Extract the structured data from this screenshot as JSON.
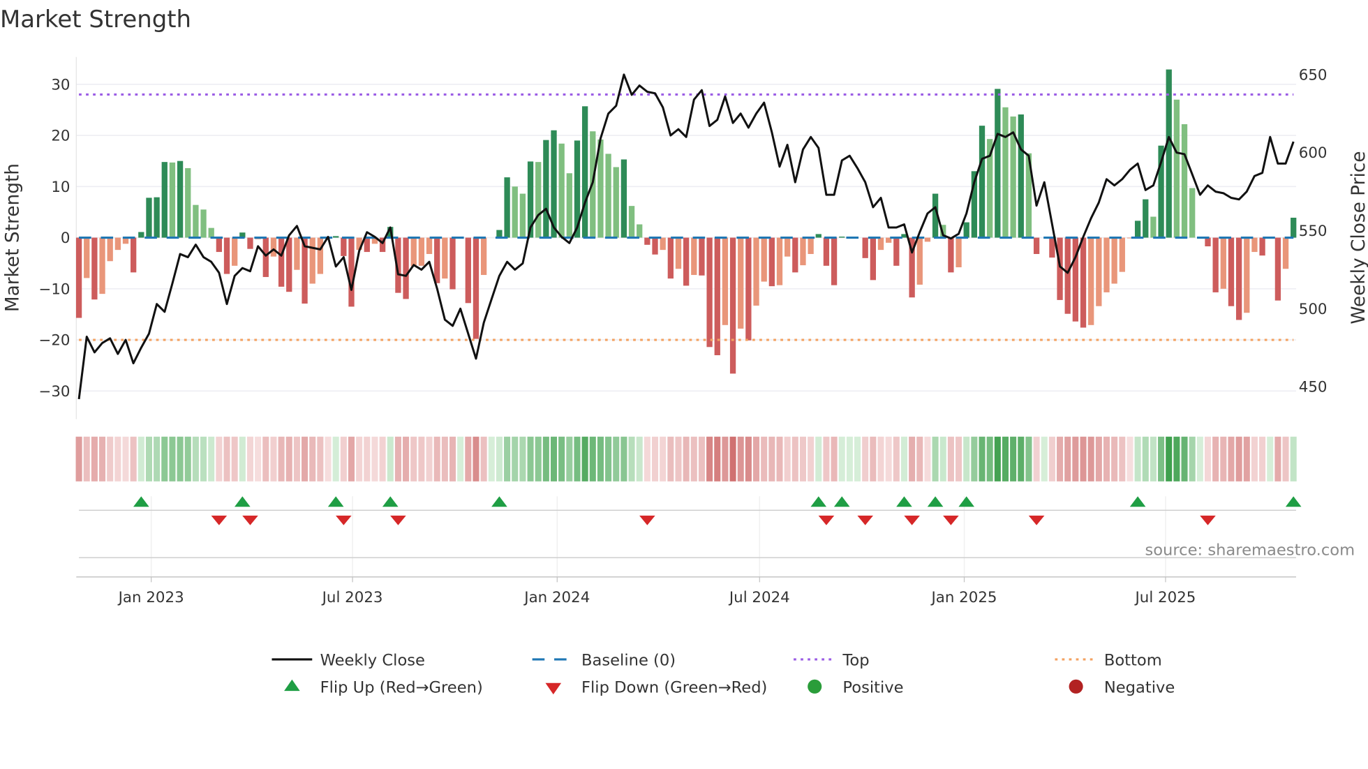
{
  "chart_data": {
    "type": "bar",
    "title": "Market Strength",
    "ylabel": "Market Strength",
    "y2label": "Weekly Close Price",
    "ylim": [
      -35,
      35
    ],
    "y2lim": [
      430,
      660
    ],
    "yticks": [
      -30,
      -20,
      -10,
      0,
      10,
      20,
      30
    ],
    "y2ticks": [
      450,
      500,
      550,
      600,
      650
    ],
    "start_date": "2022-10-28",
    "frequency": "weekly",
    "xticks": [
      {
        "date": "2023-01-01",
        "label": "Jan 2023"
      },
      {
        "date": "2023-07-01",
        "label": "Jul 2023"
      },
      {
        "date": "2024-01-01",
        "label": "Jan 2024"
      },
      {
        "date": "2024-07-01",
        "label": "Jul 2024"
      },
      {
        "date": "2025-01-01",
        "label": "Jan 2025"
      },
      {
        "date": "2025-07-01",
        "label": "Jul 2025"
      }
    ],
    "top_level": 28,
    "bottom_level": -20,
    "baseline": 0,
    "grid": true,
    "legend_position": "bottom",
    "series": [
      {
        "name": "Market Strength",
        "values": [
          -15.7,
          -7.9,
          -12.1,
          -11,
          -4.6,
          -2.4,
          -1.2,
          -6.8,
          1.1,
          7.8,
          7.9,
          14.8,
          14.7,
          15,
          13.6,
          6.4,
          5.5,
          1.9,
          -2.8,
          -7.1,
          -5.5,
          1,
          -2.2,
          -0.3,
          -7.7,
          -3.7,
          -9.6,
          -10.6,
          -6.3,
          -12.9,
          -9,
          -7.1,
          -0.2,
          0.3,
          -3.6,
          -13.5,
          -2.4,
          -2.8,
          -1.2,
          -2.8,
          2.1,
          -10.8,
          -12,
          -5.6,
          -5.5,
          -3.2,
          -8.9,
          -8,
          -10.1,
          0,
          -12.8,
          -19.8,
          -7.3,
          0,
          1.5,
          11.8,
          10,
          8.6,
          14.9,
          14.8,
          19.1,
          21,
          18.4,
          12.6,
          19,
          25.7,
          20.8,
          19.2,
          16.4,
          13.8,
          15.3,
          6.2,
          2.6,
          -1.4,
          -3.3,
          -2.4,
          -8,
          -6.1,
          -9.4,
          -7.3,
          -7.4,
          -21.4,
          -23,
          -17.1,
          -26.6,
          -17.8,
          -20.1,
          -13.3,
          -8.6,
          -9.5,
          -9.3,
          -3.7,
          -6.8,
          -5.4,
          -3.2,
          0.7,
          -5.5,
          -9.3,
          0.2,
          0,
          0,
          -4,
          -8.3,
          -2.4,
          -1,
          -5.5,
          0.7,
          -11.7,
          -9.2,
          -0.8,
          8.6,
          2.5,
          -6.8,
          -5.8,
          3,
          13,
          21.9,
          19.3,
          29.1,
          25.5,
          23.7,
          24.1,
          16.5,
          -3.2,
          0,
          -3.9,
          -12.2,
          -14.9,
          -16.4,
          -17.6,
          -17.1,
          -13.4,
          -10.7,
          -9,
          -6.7,
          -0.1,
          3.3,
          7.5,
          4.1,
          18,
          32.9,
          27,
          22.2,
          9.7,
          0,
          -1.7,
          -10.7,
          -10,
          -13.4,
          -16.1,
          -14.7,
          -2.8,
          -3.5,
          0,
          -12.3,
          -6.1,
          3.9
        ]
      },
      {
        "name": "Weekly Close",
        "axis": "right",
        "values": [
          442,
          482,
          472,
          478,
          481,
          471,
          480,
          465,
          475,
          484,
          503,
          498,
          516,
          535,
          533,
          541,
          533,
          530,
          523,
          503,
          521,
          526,
          524,
          540,
          534,
          538,
          534,
          547,
          553,
          540,
          539,
          538,
          546,
          527,
          533,
          512,
          537,
          549,
          546,
          542,
          552,
          522,
          521,
          528,
          525,
          530,
          513,
          493,
          489,
          500,
          484,
          468,
          491,
          506,
          521,
          530,
          525,
          529,
          552,
          560,
          564,
          552,
          546,
          542,
          552,
          568,
          581,
          609,
          625,
          630,
          650,
          637,
          643,
          639,
          638,
          629,
          611,
          615,
          610,
          634,
          640,
          617,
          621,
          636,
          619,
          625,
          616,
          625,
          632,
          613,
          591,
          605,
          581,
          602,
          610,
          603,
          573,
          573,
          595,
          598,
          590,
          581,
          565,
          571,
          552,
          552,
          554,
          536,
          549,
          561,
          565,
          547,
          545,
          548,
          561,
          581,
          596,
          598,
          612,
          610,
          613,
          602,
          598,
          566,
          581,
          554,
          527,
          523,
          533,
          546,
          558,
          568,
          583,
          579,
          583,
          589,
          593,
          576,
          579,
          594,
          610,
          600,
          599,
          586,
          573,
          579,
          575,
          574,
          571,
          570,
          575,
          585,
          587,
          610,
          593,
          593,
          607
        ]
      }
    ],
    "legend": [
      {
        "label": "Weekly Close"
      },
      {
        "label": "Baseline (0)"
      },
      {
        "label": "Top"
      },
      {
        "label": "Bottom"
      },
      {
        "label": "Flip Up (Red→Green)"
      },
      {
        "label": "Flip Down (Green→Red)"
      },
      {
        "label": "Positive"
      },
      {
        "label": "Negative"
      }
    ],
    "source": "source: sharemaestro.com",
    "colors": {
      "pos_up": "#2e8b57",
      "pos_down": "#80bf80",
      "neg_down": "#cd5c5c",
      "neg_up": "#e9967a",
      "line": "#111111",
      "baseline": "#1f77b4",
      "top": "#9b5de5",
      "bottom": "#f4a261",
      "flip_up": "#1f9e44",
      "flip_down": "#d62728",
      "positive": "#2a9d3a",
      "negative": "#b22222"
    }
  }
}
